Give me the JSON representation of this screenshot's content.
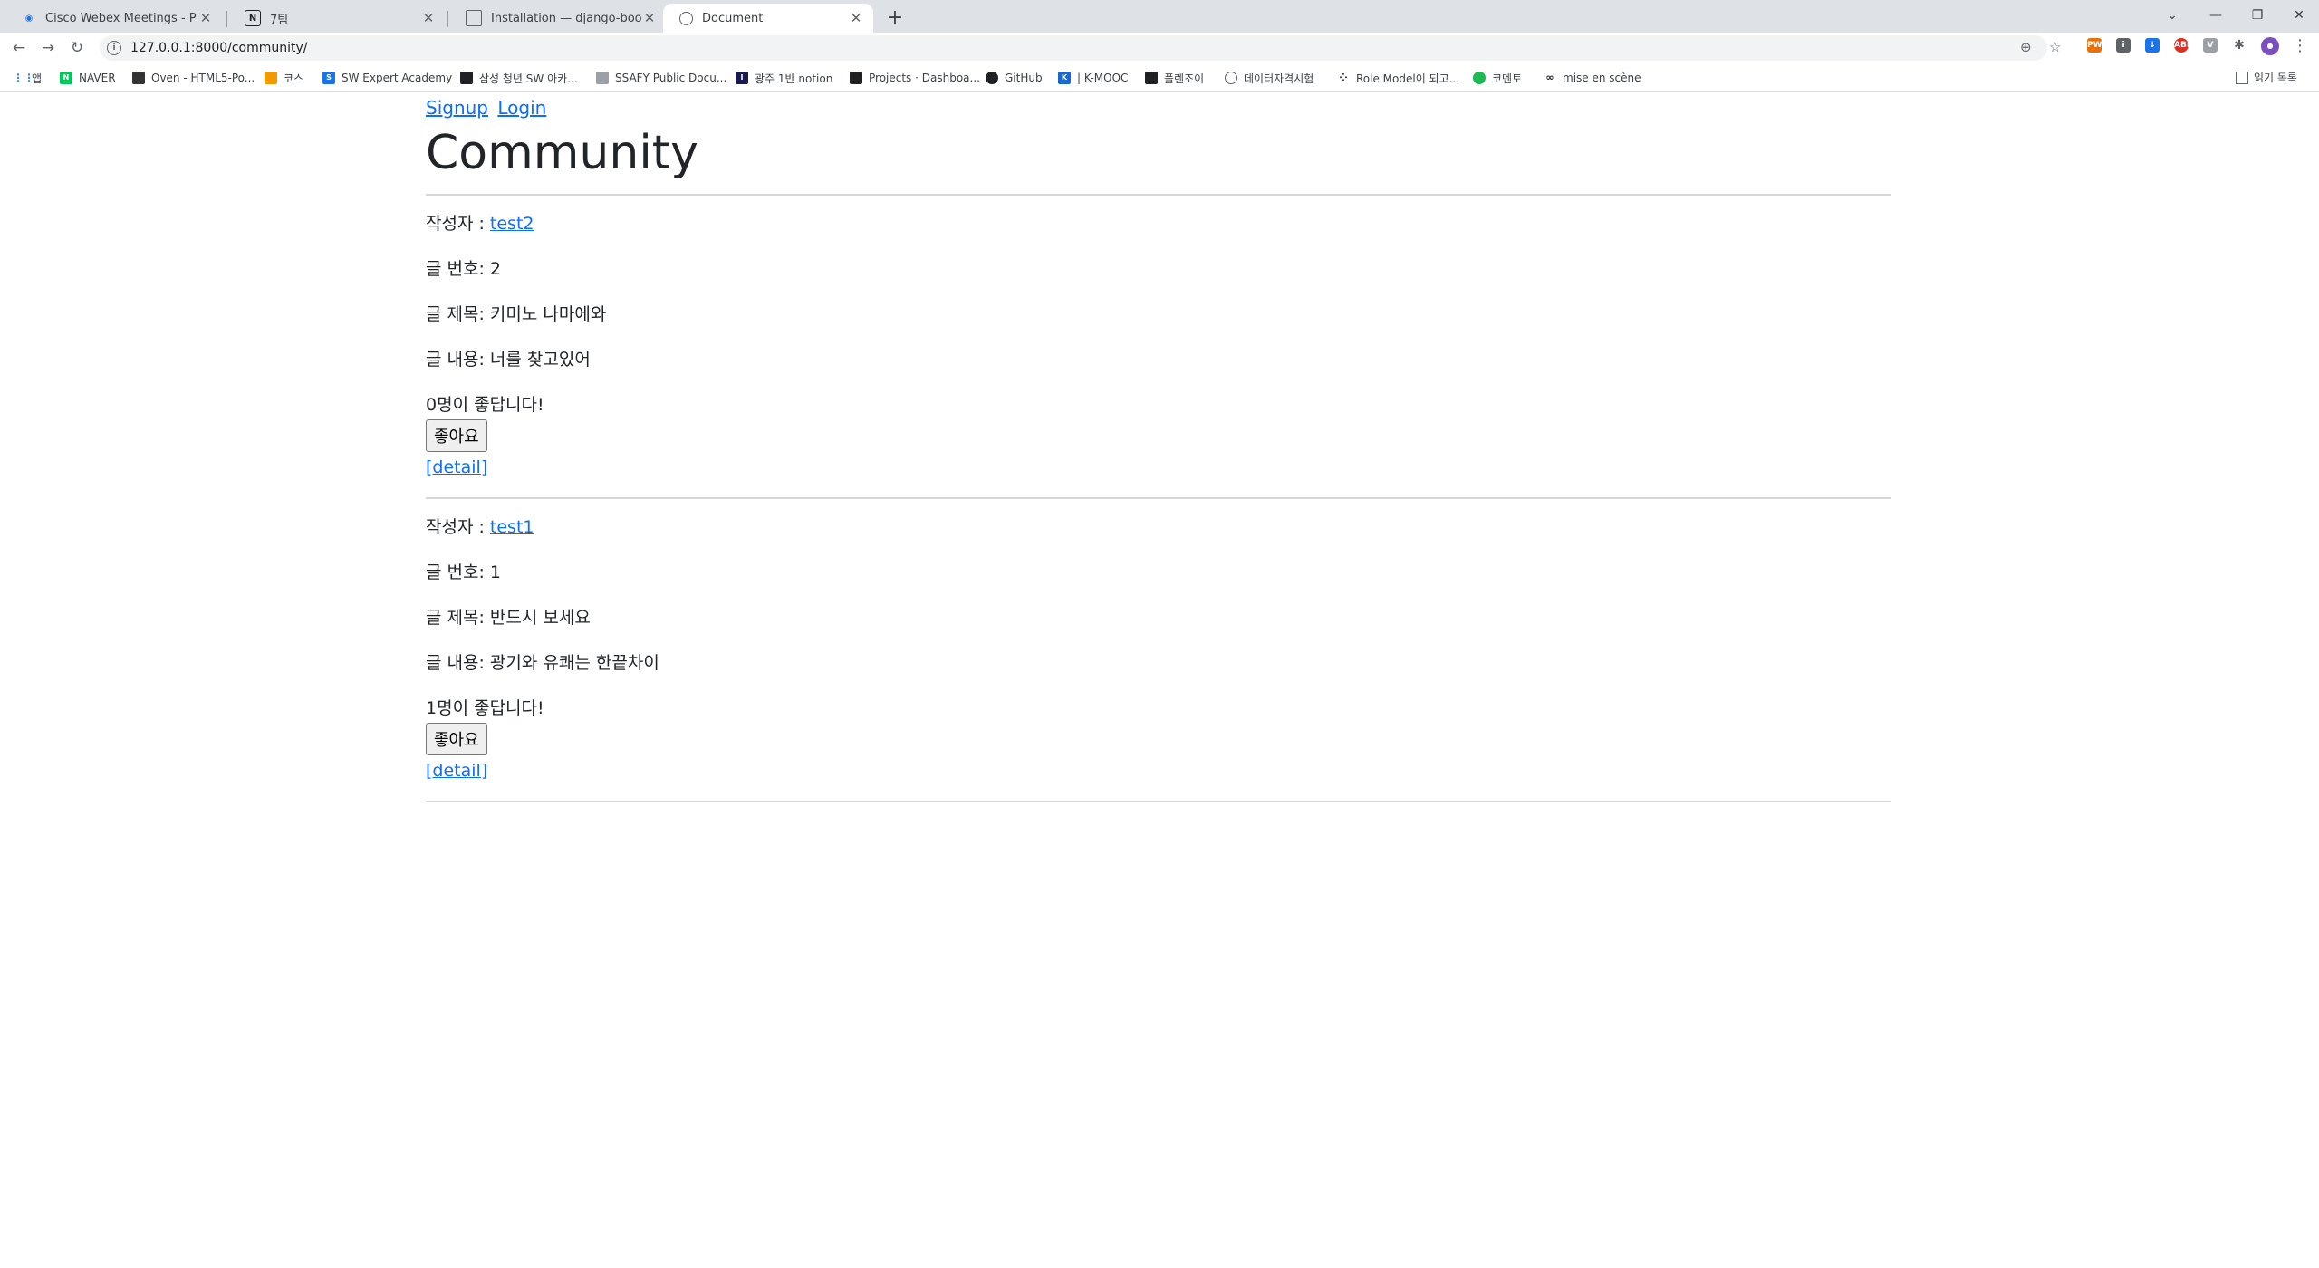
{
  "browser": {
    "tabs": [
      {
        "title": "Cisco Webex Meetings - Person",
        "icon": "webex-icon",
        "active": false
      },
      {
        "title": "7팀",
        "icon": "notion-icon",
        "active": false
      },
      {
        "title": "Installation — django-bootstrap",
        "icon": "document-icon",
        "active": false
      },
      {
        "title": "Document",
        "icon": "globe-icon",
        "active": true
      }
    ],
    "url": "127.0.0.1:8000/community/",
    "bookmarks": [
      {
        "label": "앱",
        "icon": "apps-icon",
        "color": "#4285f4"
      },
      {
        "label": "NAVER",
        "icon": "naver-icon",
        "color": "#03c75a"
      },
      {
        "label": "Oven - HTML5-Po...",
        "icon": "oven-icon",
        "color": "#333333"
      },
      {
        "label": "코스",
        "icon": "course-icon",
        "color": "#f29900"
      },
      {
        "label": "SW Expert Academy",
        "icon": "swea-icon",
        "color": "#1a73e8"
      },
      {
        "label": "삼성 청년 SW 아카...",
        "icon": "ssafy-icon",
        "color": "#202124"
      },
      {
        "label": "SSAFY Public Docu...",
        "icon": "doc-icon",
        "color": "#9aa0a6"
      },
      {
        "label": "광주 1반 notion",
        "icon": "notion-icon",
        "color": "#1a1a4e"
      },
      {
        "label": "Projects · Dashboa...",
        "icon": "gitlab-icon",
        "color": "#202124"
      },
      {
        "label": "GitHub",
        "icon": "github-icon",
        "color": "#202124"
      },
      {
        "label": "| K-MOOC",
        "icon": "kmooc-icon",
        "color": "#1967d2"
      },
      {
        "label": "플렌조이",
        "icon": "planjoy-icon",
        "color": "#202124"
      },
      {
        "label": "데이터자격시험",
        "icon": "globe-icon",
        "color": "#5f6368"
      },
      {
        "label": "Role Model이 되고...",
        "icon": "dots-icon",
        "color": "#202124"
      },
      {
        "label": "코멘토",
        "icon": "comento-icon",
        "color": "#1db954"
      },
      {
        "label": "mise en scène",
        "icon": "glasses-icon",
        "color": "#202124"
      }
    ],
    "reading_list": "읽기 목록"
  },
  "nav": {
    "signup": "Signup",
    "login": "Login"
  },
  "page_title": "Community",
  "posts": [
    {
      "author_label": "작성자 : ",
      "author": "test2",
      "number_label": "글 번호: ",
      "number": "2",
      "title_label": "글 제목: ",
      "title": "키미노 나마에와",
      "content_label": "글 내용: ",
      "content": "너를 찾고있어",
      "like_count": "0",
      "likes_suffix": "명이 좋답니다!",
      "like_button": "좋아요",
      "detail_link": "[detail]"
    },
    {
      "author_label": "작성자 : ",
      "author": "test1",
      "number_label": "글 번호: ",
      "number": "1",
      "title_label": "글 제목: ",
      "title": "반드시 보세요",
      "content_label": "글 내용: ",
      "content": "광기와 유쾌는 한끝차이",
      "like_count": "1",
      "likes_suffix": "명이 좋답니다!",
      "like_button": "좋아요",
      "detail_link": "[detail]"
    }
  ]
}
